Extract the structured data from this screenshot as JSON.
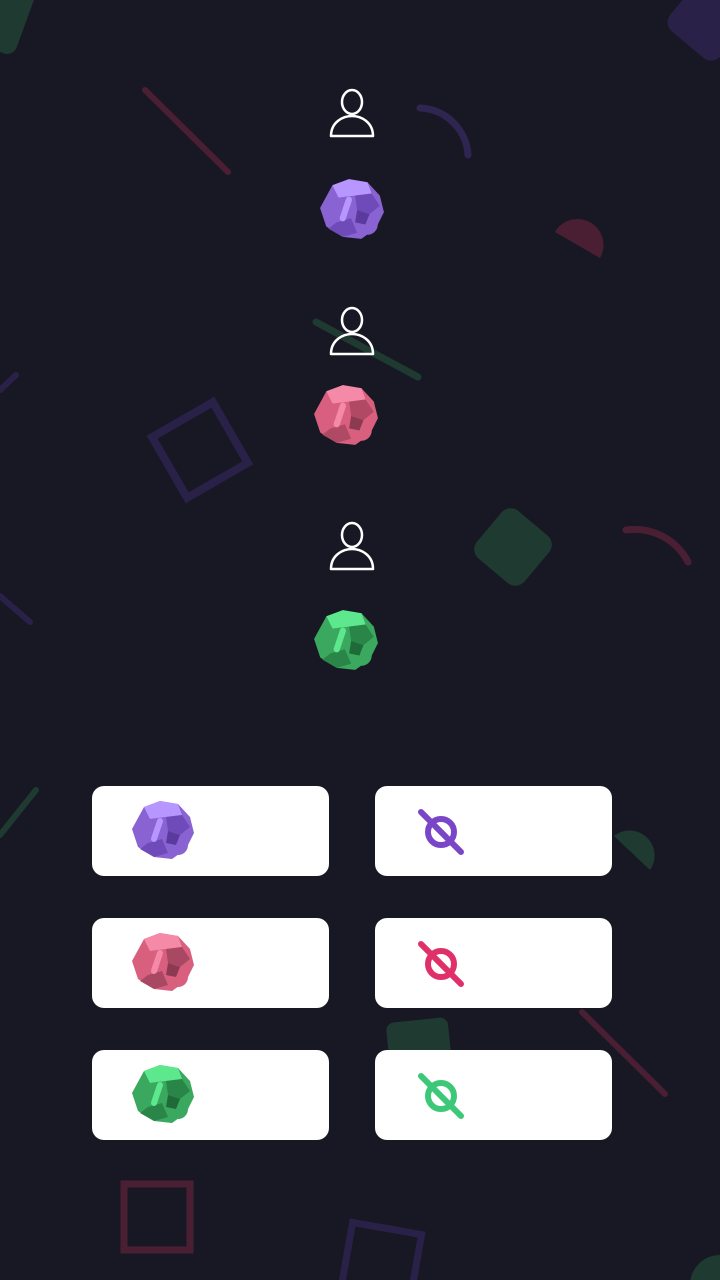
{
  "colors": {
    "background": "#181824",
    "purple": "#8a63d2",
    "pink": "#d8607e",
    "green": "#3fbf6a",
    "hide_purple": "#7a46c8",
    "hide_pink": "#e0306a",
    "hide_green": "#3cc878"
  },
  "slots": [
    {
      "player_icon": "user-icon",
      "gem": "purple-gem"
    },
    {
      "player_icon": "user-icon",
      "gem": "pink-gem"
    },
    {
      "player_icon": "user-icon",
      "gem": "green-gem"
    }
  ],
  "buttons": [
    {
      "type": "gem-button",
      "icon": "purple-gem-icon"
    },
    {
      "type": "hide-button",
      "icon": "eye-slash-icon"
    },
    {
      "type": "gem-button",
      "icon": "pink-gem-icon"
    },
    {
      "type": "hide-button",
      "icon": "eye-slash-icon"
    },
    {
      "type": "gem-button",
      "icon": "green-gem-icon"
    },
    {
      "type": "hide-button",
      "icon": "eye-slash-icon"
    }
  ]
}
